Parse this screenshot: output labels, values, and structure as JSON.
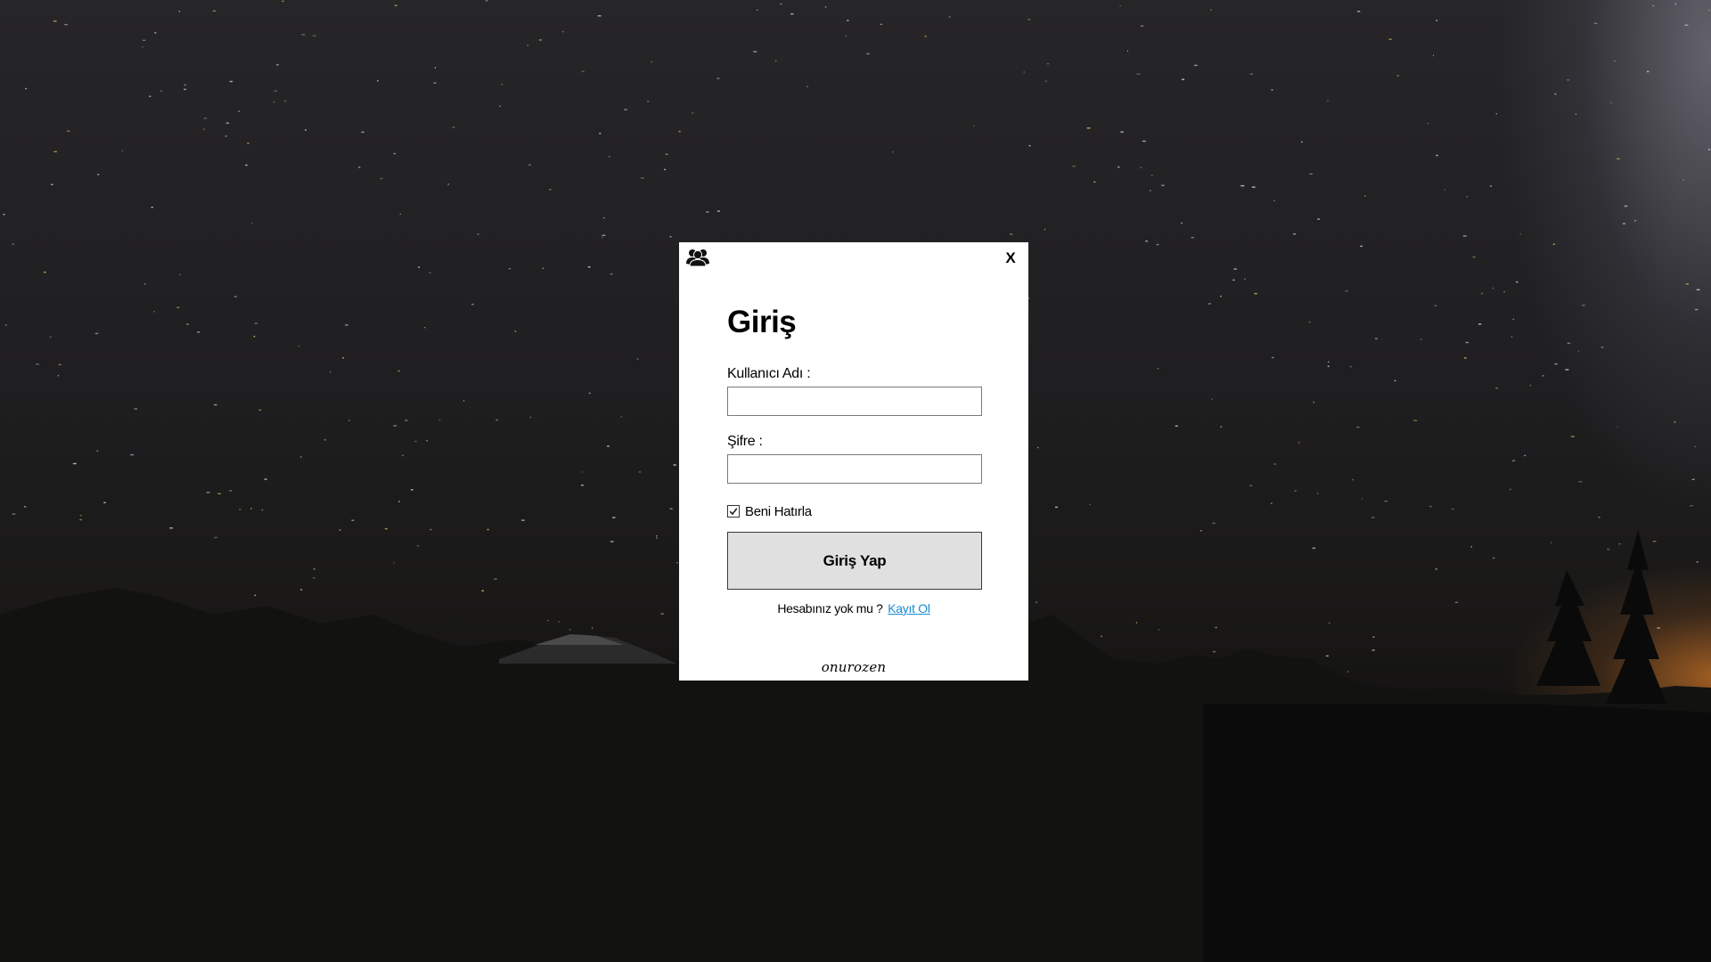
{
  "dialog": {
    "title": "Giriş",
    "close_label": "X",
    "app_icon": "users-icon",
    "username": {
      "label": "Kullanıcı Adı :",
      "value": "",
      "placeholder": ""
    },
    "password": {
      "label": "Şifre :",
      "value": "",
      "placeholder": ""
    },
    "remember_me": {
      "label": "Beni Hatırla",
      "checked": true
    },
    "login_button_label": "Giriş Yap",
    "signup_prompt": "Hesabınız yok mu ?",
    "signup_link_label": "Kayıt Ol",
    "footer_signature": "onurozen"
  },
  "colors": {
    "link": "#1a8ad4",
    "button_bg": "#e0e0e0",
    "dialog_bg": "#ffffff"
  }
}
